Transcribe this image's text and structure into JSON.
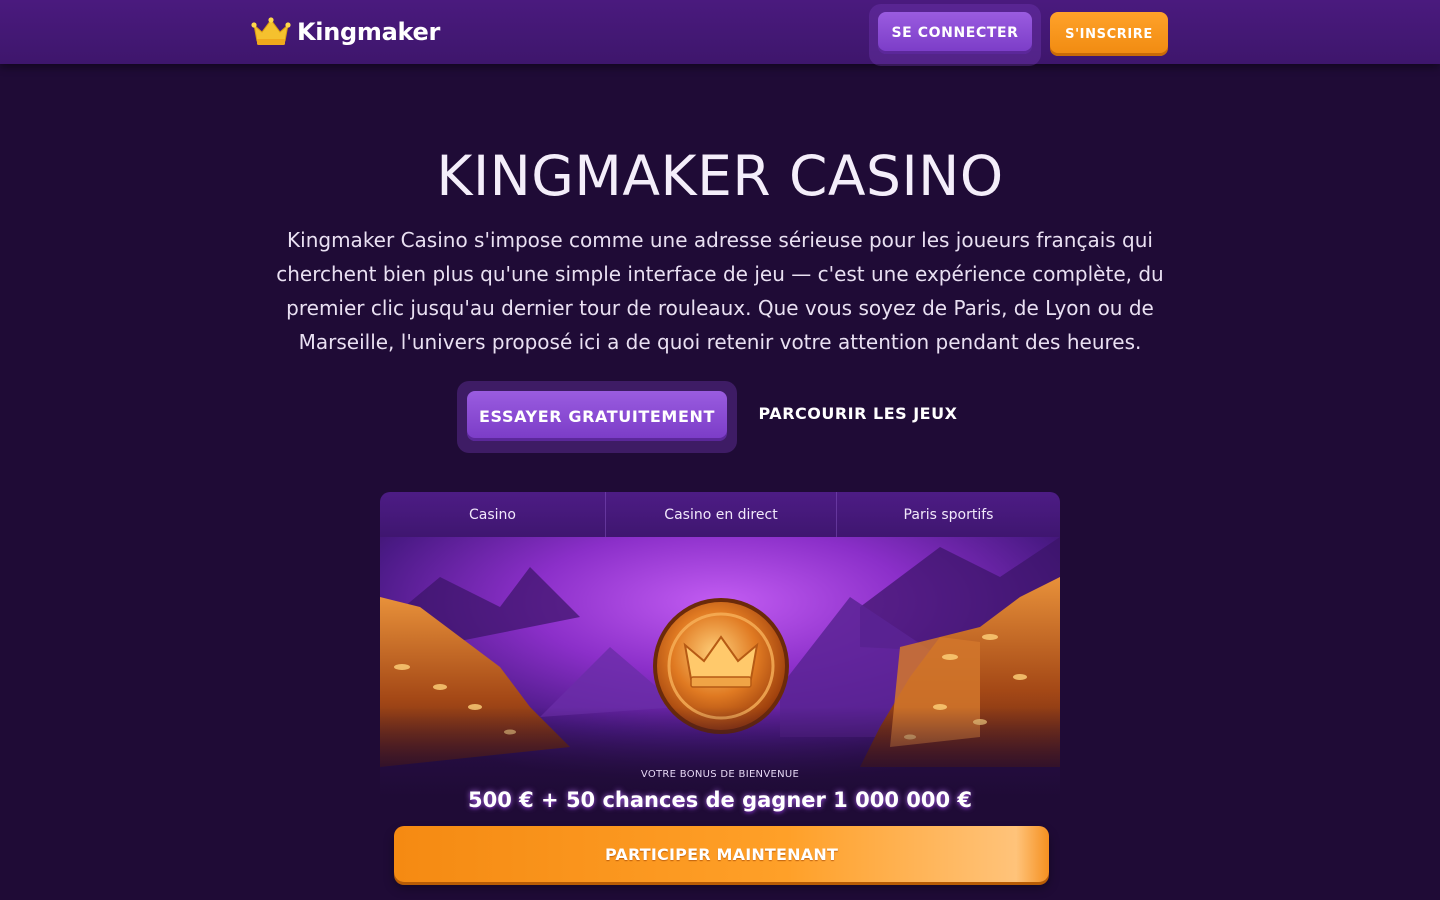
{
  "header": {
    "logo_text": "Kingmaker",
    "login_label": "SE CONNECTER",
    "signup_label": "S'INSCRIRE"
  },
  "hero": {
    "title": "KINGMAKER CASINO",
    "description": "Kingmaker Casino s'impose comme une adresse sérieuse pour les joueurs français qui cherchent bien plus qu'une simple interface de jeu — c'est une expérience complète, du premier clic jusqu'au dernier tour de rouleaux. Que vous soyez de Paris, de Lyon ou de Marseille, l'univers proposé ici a de quoi retenir votre attention pendant des heures.",
    "primary_button": "ESSAYER GRATUITEMENT",
    "secondary_link": "PARCOURIR LES JEUX"
  },
  "promo": {
    "tabs": [
      {
        "label": "Casino"
      },
      {
        "label": "Casino en direct"
      },
      {
        "label": "Paris sportifs"
      }
    ],
    "bonus_label": "VOTRE BONUS DE BIENVENUE",
    "bonus_value": "500 € + 50 chances de gagner 1 000 000 €",
    "cta_label": "PARTICIPER MAINTENANT"
  },
  "colors": {
    "background": "#1f0b36",
    "header": "#4a1a7e",
    "purple_button": "#8a4ad6",
    "orange_button": "#f7941d",
    "crown": "#f5c12e"
  },
  "icons": {
    "logo": "crown-icon",
    "medallion": "crown-coin-icon"
  }
}
